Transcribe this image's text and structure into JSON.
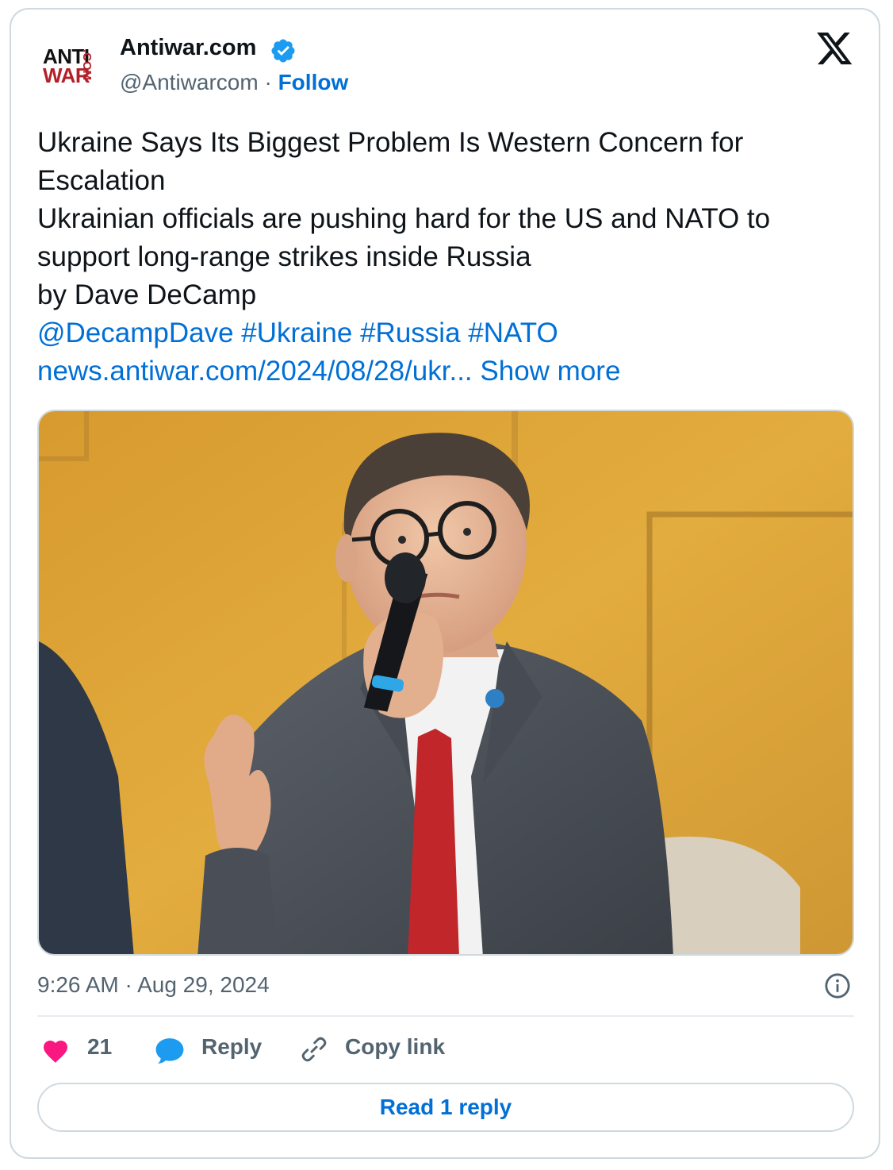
{
  "account": {
    "logo_top": "ANTI",
    "logo_bottom": "WAR",
    "logo_side": ".COM",
    "display_name": "Antiwar.com",
    "handle": "@Antiwarcom",
    "separator": " · ",
    "follow_label": "Follow",
    "verified_icon": "verified-badge-icon"
  },
  "tweet": {
    "lines": [
      "Ukraine Says Its Biggest Problem Is Western Concern for",
      "Escalation",
      "Ukrainian officials are pushing hard for the US and NATO to",
      "support long-range strikes inside Russia",
      "by Dave DeCamp"
    ],
    "mentions_line": "@DecampDave #Ukraine #Russia #NATO",
    "url": "news.antiwar.com/2024/08/28/ukr...",
    "show_more": "Show more"
  },
  "meta": {
    "timestamp": "9:26 AM · Aug 29, 2024"
  },
  "actions": {
    "like_count": "21",
    "reply_label": "Reply",
    "copy_label": "Copy link",
    "read_replies_label": "Read 1 reply"
  },
  "colors": {
    "link": "#006fd6",
    "heart": "#f91880",
    "reply_bubble": "#1d9bf0",
    "secondary_text": "#536471",
    "border": "#cfd9de",
    "logo_red": "#b3202a"
  }
}
